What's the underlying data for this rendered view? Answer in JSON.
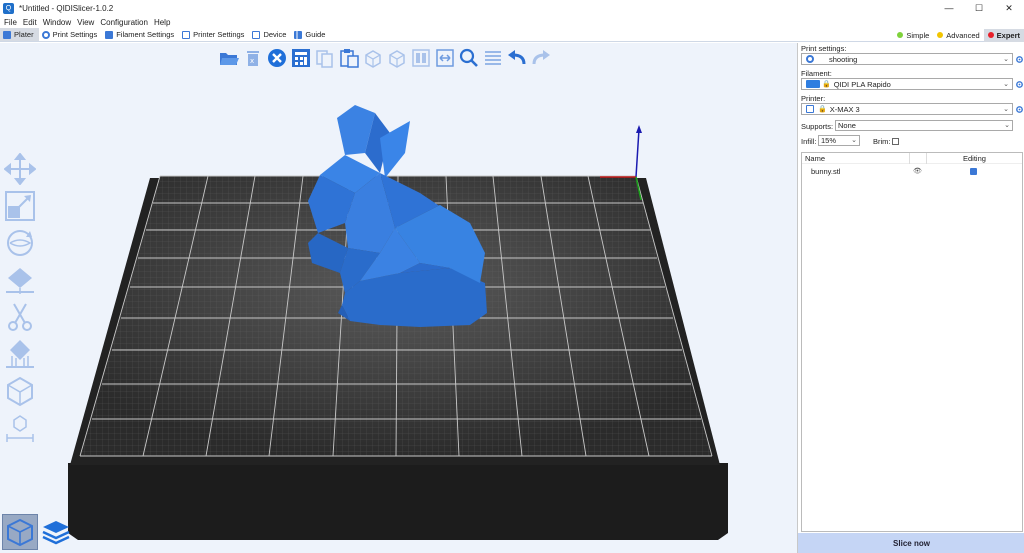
{
  "app": {
    "window_title": "*Untitled - QIDISlicer-1.0.2",
    "minimize": "—",
    "maximize": "☐",
    "close": "✕"
  },
  "menu": [
    "File",
    "Edit",
    "Window",
    "View",
    "Configuration",
    "Help"
  ],
  "tabs": [
    {
      "label": "Plater",
      "active": true
    },
    {
      "label": "Print Settings",
      "active": false
    },
    {
      "label": "Filament Settings",
      "active": false
    },
    {
      "label": "Printer Settings",
      "active": false
    },
    {
      "label": "Device",
      "active": false
    },
    {
      "label": "Guide",
      "active": false
    }
  ],
  "modes": [
    {
      "label": "Simple",
      "color": "#7fd23b",
      "active": false
    },
    {
      "label": "Advanced",
      "color": "#f2c500",
      "active": false
    },
    {
      "label": "Expert",
      "color": "#e8202a",
      "active": true
    }
  ],
  "toolbar_top": [
    "open-folder-icon",
    "delete-icon",
    "delete-all-icon",
    "arrange-icon",
    "copy-icon",
    "paste-icon",
    "add-instance-icon",
    "remove-instance-icon",
    "split-objects-icon",
    "split-parts-icon",
    "search-icon",
    "layers-editing-icon",
    "undo-icon",
    "redo-icon"
  ],
  "toolbar_left": [
    "move-icon",
    "scale-icon",
    "rotate-icon",
    "place-on-face-icon",
    "cut-icon",
    "support-paint-icon",
    "seam-paint-icon",
    "measure-icon"
  ],
  "view_toggle": [
    "3d-view-icon",
    "preview-layers-icon"
  ],
  "sidebar": {
    "print_settings_label": "Print settings:",
    "print_settings_value": "shooting",
    "filament_label": "Filament:",
    "filament_value": "QIDI PLA Rapido",
    "filament_color": "#2f7ee0",
    "printer_label": "Printer:",
    "printer_value": "X-MAX 3",
    "supports_label": "Supports:",
    "supports_value": "None",
    "infill_label": "Infill:",
    "infill_value": "15%",
    "brim_label": "Brim:",
    "brim_checked": false,
    "list_header_name": "Name",
    "list_header_editing": "Editing",
    "objects": [
      {
        "name": "bunny.stl"
      }
    ],
    "slice_button": "Slice now"
  },
  "colors": {
    "accent": "#3b78d6",
    "model": "#2f73d6",
    "bed": "#3a3a3a",
    "viewport_bg": "#eef3fb"
  }
}
